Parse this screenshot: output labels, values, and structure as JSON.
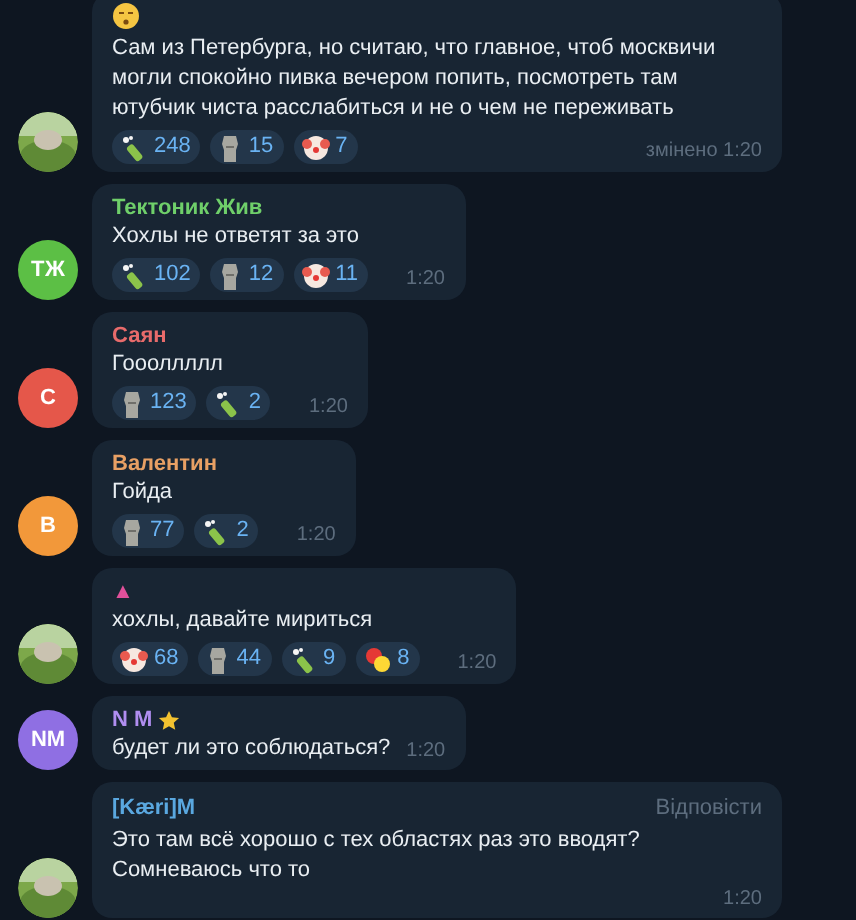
{
  "messages": [
    {
      "avatar": {
        "kind": "picture"
      },
      "header_icon": true,
      "text": "Сам из Петербурга, но считаю, что главное, чтоб москвичи могли спокойно пивка вечером попить, посмотреть там ютубчик чиста расслабиться и не о чем не переживать",
      "reactions": [
        {
          "kind": "bottle",
          "count": "248"
        },
        {
          "kind": "moai",
          "count": "15"
        },
        {
          "kind": "clown",
          "count": "7"
        }
      ],
      "time": "змінено 1:20"
    },
    {
      "avatar": {
        "kind": "initials",
        "initials": "ТЖ",
        "color": "#5cbf45"
      },
      "sender": {
        "name": "Тектоник Жив",
        "color": "#6fcf6a"
      },
      "text": "Хохлы не ответят за это",
      "reactions": [
        {
          "kind": "bottle",
          "count": "102"
        },
        {
          "kind": "moai",
          "count": "12"
        },
        {
          "kind": "clown",
          "count": "11"
        }
      ],
      "time": "1:20"
    },
    {
      "avatar": {
        "kind": "initials",
        "initials": "С",
        "color": "#e5574a"
      },
      "sender": {
        "name": "Саян",
        "color": "#e86b6b"
      },
      "text": "Гоооллллл",
      "reactions": [
        {
          "kind": "moai",
          "count": "123"
        },
        {
          "kind": "bottle",
          "count": "2"
        }
      ],
      "time": "1:20"
    },
    {
      "avatar": {
        "kind": "initials",
        "initials": "В",
        "color": "#f2983a"
      },
      "sender": {
        "name": "Валентин",
        "color": "#e8a064"
      },
      "text": "Гойда",
      "reactions": [
        {
          "kind": "moai",
          "count": "77"
        },
        {
          "kind": "bottle",
          "count": "2"
        }
      ],
      "time": "1:20"
    },
    {
      "avatar": {
        "kind": "picture"
      },
      "sender": {
        "name": "▲",
        "color": "#e0509a"
      },
      "text": "хохлы, давайте мириться",
      "reactions": [
        {
          "kind": "clown",
          "count": "68"
        },
        {
          "kind": "moai",
          "count": "44"
        },
        {
          "kind": "bottle",
          "count": "9"
        },
        {
          "kind": "burst",
          "count": "8"
        }
      ],
      "time": "1:20"
    },
    {
      "avatar": {
        "kind": "initials",
        "initials": "NM",
        "color": "#8f6fe3"
      },
      "sender": {
        "name": "N M",
        "color": "#b08ef0",
        "star": true
      },
      "text": "будет ли это соблюдаться?",
      "time": "1:20"
    },
    {
      "avatar": {
        "kind": "picture"
      },
      "sender": {
        "name": "[Kæri]M",
        "color": "#5aa8e0"
      },
      "reply": "Відповісти",
      "text": "Это там всё хорошо с тех областях раз это вводят? Сомневаюсь что то",
      "time": "1:20"
    }
  ]
}
